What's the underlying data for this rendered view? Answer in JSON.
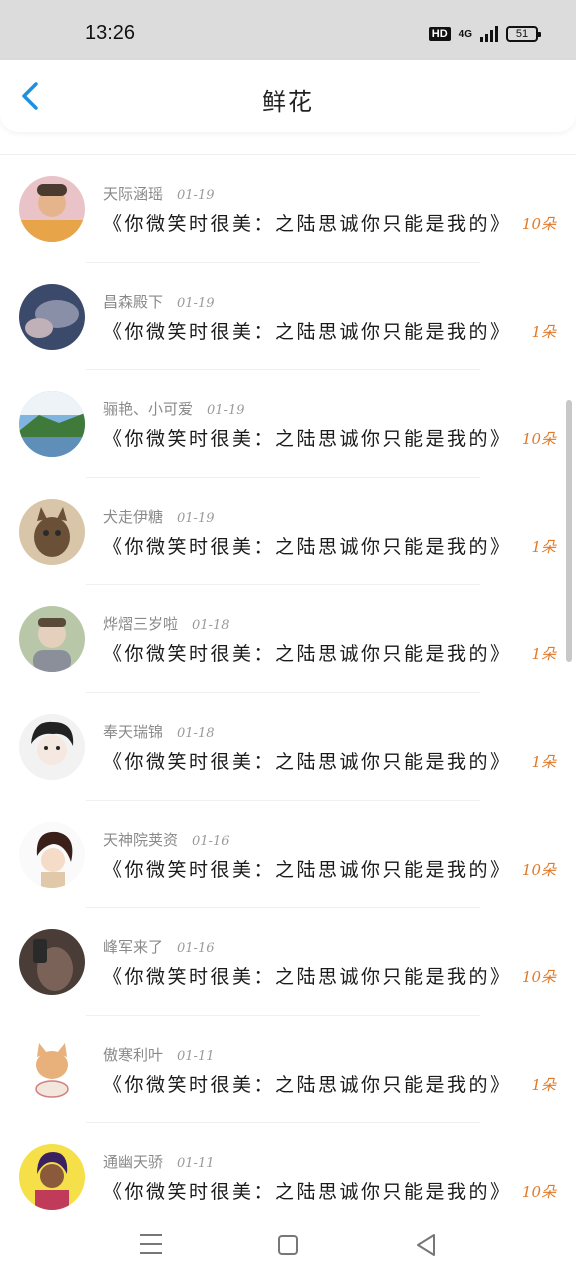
{
  "status_bar": {
    "time": "13:26",
    "hd": "HD",
    "network": "4G",
    "battery": "51"
  },
  "header": {
    "title": "鲜花"
  },
  "colors": {
    "accent": "#1e90e0",
    "count": "#e07a2a"
  },
  "items": [
    {
      "name": "天际涵瑶",
      "date": "01-19",
      "book": "《你微笑时很美：之陆思诚你只能是我的》",
      "count": "10朵",
      "avatar": "woman-photo"
    },
    {
      "name": "昌森殿下",
      "date": "01-19",
      "book": "《你微笑时很美：之陆思诚你只能是我的》",
      "count": "1朵",
      "avatar": "dark-photo"
    },
    {
      "name": "骊艳、小可爱",
      "date": "01-19",
      "book": "《你微笑时很美：之陆思诚你只能是我的》",
      "count": "10朵",
      "avatar": "landscape-photo"
    },
    {
      "name": "犬走伊糖",
      "date": "01-19",
      "book": "《你微笑时很美：之陆思诚你只能是我的》",
      "count": "1朵",
      "avatar": "cat-photo"
    },
    {
      "name": "烨熠三岁啦",
      "date": "01-18",
      "book": "《你微笑时很美：之陆思诚你只能是我的》",
      "count": "1朵",
      "avatar": "boy-photo"
    },
    {
      "name": "奉天瑞锦",
      "date": "01-18",
      "book": "《你微笑时很美：之陆思诚你只能是我的》",
      "count": "1朵",
      "avatar": "anime-boy"
    },
    {
      "name": "天神院荚资",
      "date": "01-16",
      "book": "《你微笑时很美：之陆思诚你只能是我的》",
      "count": "10朵",
      "avatar": "anime-girl"
    },
    {
      "name": "峰军来了",
      "date": "01-16",
      "book": "《你微笑时很美：之陆思诚你只能是我的》",
      "count": "10朵",
      "avatar": "selfie-photo"
    },
    {
      "name": "傲寒利叶",
      "date": "01-11",
      "book": "《你微笑时很美：之陆思诚你只能是我的》",
      "count": "1朵",
      "avatar": "cat-cartoon"
    },
    {
      "name": "通幽天骄",
      "date": "01-11",
      "book": "《你微笑时很美：之陆思诚你只能是我的》",
      "count": "10朵",
      "avatar": "cartoon-girl"
    }
  ]
}
